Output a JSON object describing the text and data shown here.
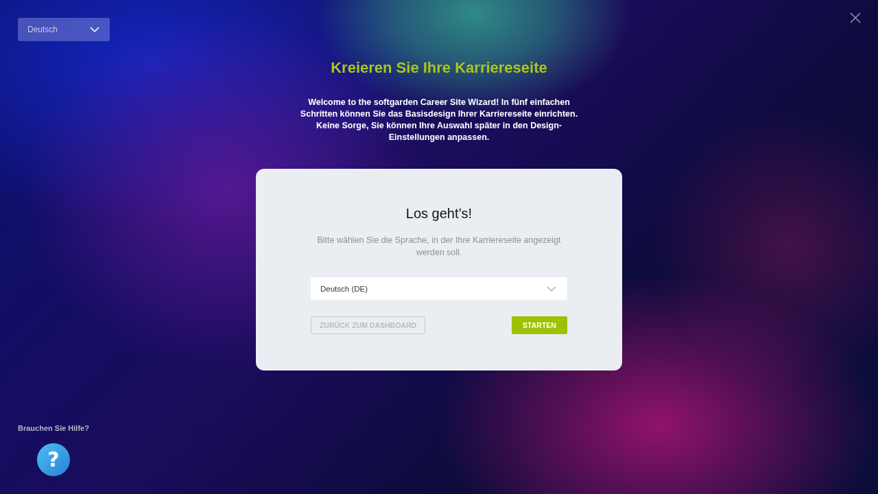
{
  "language_select": {
    "value": "Deutsch"
  },
  "title": "Kreieren Sie Ihre Karriereseite",
  "intro": "Welcome to the softgarden Career Site Wizard! In fünf einfachen Schritten können Sie das Basisdesign Ihrer Karriereseite einrichten. Keine Sorge, Sie können Ihre Auswahl später in den Design-Einstellungen anpassen.",
  "card": {
    "heading": "Los geht’s!",
    "description": "Bitte wählen Sie die Sprache, in der Ihre Karriereseite angezeigt werden soll.",
    "language_field": {
      "value": "Deutsch (DE)"
    },
    "buttons": [
      {
        "label": "ZURÜCK ZUM DASHBOARD",
        "kind": "secondary"
      },
      {
        "label": "STARTEN",
        "kind": "primary"
      }
    ]
  },
  "help": {
    "label": "Brauchen Sie Hilfe?",
    "button": "?"
  }
}
